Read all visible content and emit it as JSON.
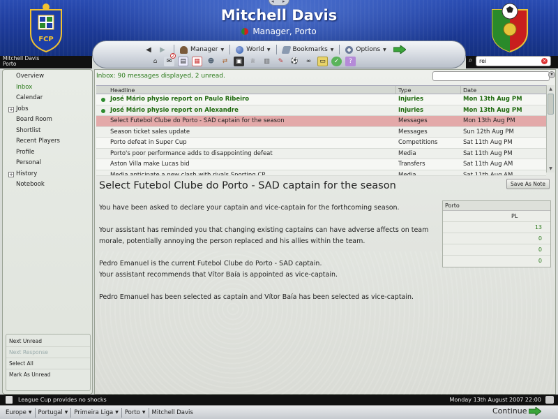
{
  "header": {
    "manager_name": "Mitchell Davis",
    "manager_role": "Manager, Porto",
    "brand_color": "#1e3c9c",
    "crest_text": "FCP"
  },
  "navbar": {
    "back_icon": "back-arrow-icon",
    "forward_icon": "forward-arrow-icon",
    "menus": [
      {
        "label": "Manager",
        "icon": "manager-icon"
      },
      {
        "label": "World",
        "icon": "globe-icon"
      },
      {
        "label": "Bookmarks",
        "icon": "bookmark-icon"
      },
      {
        "label": "Options",
        "icon": "options-icon"
      }
    ],
    "toolbar_icons": [
      "home-icon",
      "inbox-icon",
      "news-icon",
      "calendar-icon",
      "squad-icon",
      "transfers-icon",
      "tactics-icon",
      "trophy-icon",
      "training-icon",
      "finance-icon",
      "match-icon",
      "scout-icon",
      "notes-icon",
      "help-icon",
      "question-icon"
    ],
    "inbox_badge": "2"
  },
  "manager_strip": {
    "name": "Mitchell Davis",
    "club": "Porto"
  },
  "search": {
    "value": "rei"
  },
  "sidebar": {
    "items": [
      {
        "label": "Overview",
        "active": false,
        "expandable": false
      },
      {
        "label": "Inbox",
        "active": true,
        "expandable": false
      },
      {
        "label": "Calendar",
        "active": false,
        "expandable": false
      },
      {
        "label": "Jobs",
        "active": false,
        "expandable": true
      },
      {
        "label": "Board Room",
        "active": false,
        "expandable": false
      },
      {
        "label": "Shortlist",
        "active": false,
        "expandable": false
      },
      {
        "label": "Recent Players",
        "active": false,
        "expandable": false
      },
      {
        "label": "Profile",
        "active": false,
        "expandable": false
      },
      {
        "label": "Personal",
        "active": false,
        "expandable": false
      },
      {
        "label": "History",
        "active": false,
        "expandable": true
      },
      {
        "label": "Notebook",
        "active": false,
        "expandable": false
      }
    ],
    "actions": [
      {
        "label": "Next Unread",
        "enabled": true
      },
      {
        "label": "Next Response",
        "enabled": false
      },
      {
        "label": "Select All",
        "enabled": true
      },
      {
        "label": "Mark As Unread",
        "enabled": true
      }
    ]
  },
  "inbox": {
    "status": "Inbox: 90 messages displayed, 2 unread.",
    "columns": {
      "headline": "Headline",
      "type": "Type",
      "date": "Date"
    },
    "messages": [
      {
        "headline": "José Mário physio report on Paulo Ribeiro",
        "type": "Injuries",
        "date": "Mon 13th Aug PM",
        "unread": true,
        "selected": false
      },
      {
        "headline": "José Mário physio report on Alexandre",
        "type": "Injuries",
        "date": "Mon 13th Aug PM",
        "unread": true,
        "selected": false
      },
      {
        "headline": "Select Futebol Clube do Porto - SAD captain for the season",
        "type": "Messages",
        "date": "Mon 13th Aug PM",
        "unread": false,
        "selected": true
      },
      {
        "headline": "Season ticket sales update",
        "type": "Messages",
        "date": "Sun 12th Aug PM",
        "unread": false,
        "selected": false
      },
      {
        "headline": "Porto defeat in Super Cup",
        "type": "Competitions",
        "date": "Sat 11th Aug PM",
        "unread": false,
        "selected": false
      },
      {
        "headline": "Porto's poor performance adds to disappointing defeat",
        "type": "Media",
        "date": "Sat 11th Aug PM",
        "unread": false,
        "selected": false
      },
      {
        "headline": "Aston Villa make Lucas bid",
        "type": "Transfers",
        "date": "Sat 11th Aug AM",
        "unread": false,
        "selected": false
      },
      {
        "headline": "Media anticipate a new clash with rivals Sporting CP",
        "type": "Media",
        "date": "Sat 11th Aug AM",
        "unread": false,
        "selected": false
      }
    ]
  },
  "message": {
    "title": "Select Futebol Clube do Porto - SAD captain for the season",
    "save_note_label": "Save As Note",
    "paragraphs": [
      "You have been asked to declare your captain and vice-captain for the forthcoming season.",
      "Your assistant has reminded you that changing existing captains can have adverse affects on team morale, potentially annoying the person replaced and his allies within the team.",
      "Pedro Emanuel is the current Futebol Clube do Porto - SAD captain.\nYour assistant recommends that Vítor Baía is appointed as vice-captain.",
      "Pedro Emanuel has been selected as captain and Vítor Baía has been selected as vice-captain."
    ]
  },
  "squad_box": {
    "title": "Porto",
    "column": "PL",
    "values": [
      "13",
      "0",
      "0",
      "0"
    ]
  },
  "news_bar": {
    "headline": "League Cup provides no shocks",
    "datetime": "Monday 13th August 2007 22:00"
  },
  "breadcrumbs": [
    "Europe",
    "Portugal",
    "Primeira Liga",
    "Porto",
    "Mitchell Davis"
  ],
  "continue_label": "Continue",
  "colors": {
    "unread_green": "#1f6a0f",
    "selected_row": "#e3a9a9",
    "continue_green": "#3aa43a"
  }
}
